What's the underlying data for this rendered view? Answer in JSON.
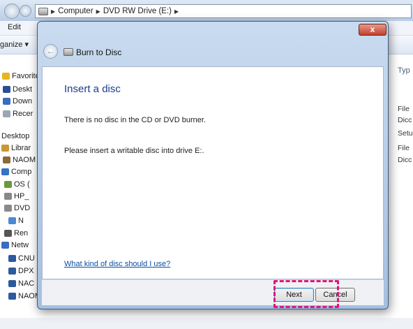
{
  "explorer": {
    "address": {
      "seg1": "Computer",
      "seg2": "DVD RW Drive (E:)"
    },
    "menu_edit": "Edit",
    "organize": "ganize ▾",
    "nav_items": [
      {
        "label": "Favorite",
        "icon": "star-icon",
        "color": "#e7b521"
      },
      {
        "label": "Deskt",
        "icon": "desktop-icon",
        "color": "#2b4f93"
      },
      {
        "label": "Down",
        "icon": "downloads-icon",
        "color": "#3a6cc0"
      },
      {
        "label": "Recer",
        "icon": "recent-places-icon",
        "color": "#9aa6b4"
      },
      {
        "label": "Desktop",
        "icon": "",
        "color": ""
      },
      {
        "label": "Librar",
        "icon": "libraries-icon",
        "color": "#c99734"
      },
      {
        "label": "NAOM",
        "icon": "user-icon",
        "color": "#8a6a3a"
      },
      {
        "label": "Comp",
        "icon": "computer-icon",
        "color": "#3672c5"
      },
      {
        "label": "OS (",
        "icon": "os-drive-icon",
        "color": "#6a9a3a"
      },
      {
        "label": "HP_",
        "icon": "drive-icon",
        "color": "#888888"
      },
      {
        "label": "DVD",
        "icon": "dvd-drive-icon",
        "color": "#8a8a8a"
      },
      {
        "label": "N",
        "icon": "file-icon",
        "color": "#4a8ad0"
      },
      {
        "label": "Ren",
        "icon": "removable-drive-icon",
        "color": "#555555"
      },
      {
        "label": "Netw",
        "icon": "network-icon",
        "color": "#3a6cc0"
      },
      {
        "label": "CNU",
        "icon": "network-pc-icon",
        "color": "#2d5a9e"
      },
      {
        "label": "DPX",
        "icon": "network-pc-icon",
        "color": "#2d5a9e"
      },
      {
        "label": "NAC",
        "icon": "network-pc-icon",
        "color": "#2d5a9e"
      },
      {
        "label": "NAOMI-XRAY-A",
        "icon": "network-pc-icon",
        "color": "#2d5a9e"
      }
    ],
    "col_type": "Typ",
    "right_items": [
      "File",
      "Dicc",
      "Setu",
      "File",
      "Dicc"
    ]
  },
  "dialog": {
    "close": "x",
    "title": "Burn to Disc",
    "instruction": "Insert a disc",
    "message1": "There is no disc in the CD or DVD burner.",
    "message2": "Please insert a writable disc into drive E:.",
    "help_link": "What kind of disc should I use?",
    "next_label": "Next",
    "cancel_label": "Cancel"
  }
}
